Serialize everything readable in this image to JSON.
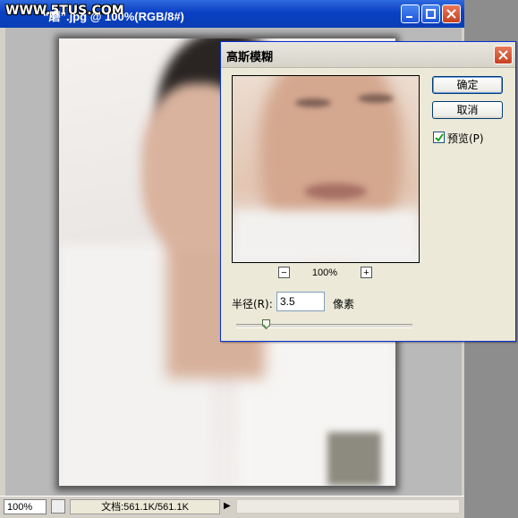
{
  "document": {
    "watermark": "WWW.5TUS.COM",
    "title": "“磨”.jpg @ 100%(RGB/8#)",
    "zoom": "100%",
    "doc_size": "文档:561.1K/561.1K"
  },
  "dialog": {
    "title": "高斯模糊",
    "ok_label": "确定",
    "cancel_label": "取消",
    "preview_label": "预览(P)",
    "preview_checked": true,
    "zoom_level": "100%",
    "zoom_minus": "−",
    "zoom_plus": "+",
    "radius_label": "半径(R):",
    "radius_value": "3.5",
    "radius_unit": "像素",
    "slider_fraction": 0.17
  },
  "colors": {
    "titlebar": "#0a3fc2",
    "dialog_bg": "#ece9d8"
  },
  "icons": [
    "minimize-icon",
    "maximize-icon",
    "close-icon",
    "checkmark-icon",
    "slider-thumb-icon",
    "status-menu-arrow-icon"
  ]
}
